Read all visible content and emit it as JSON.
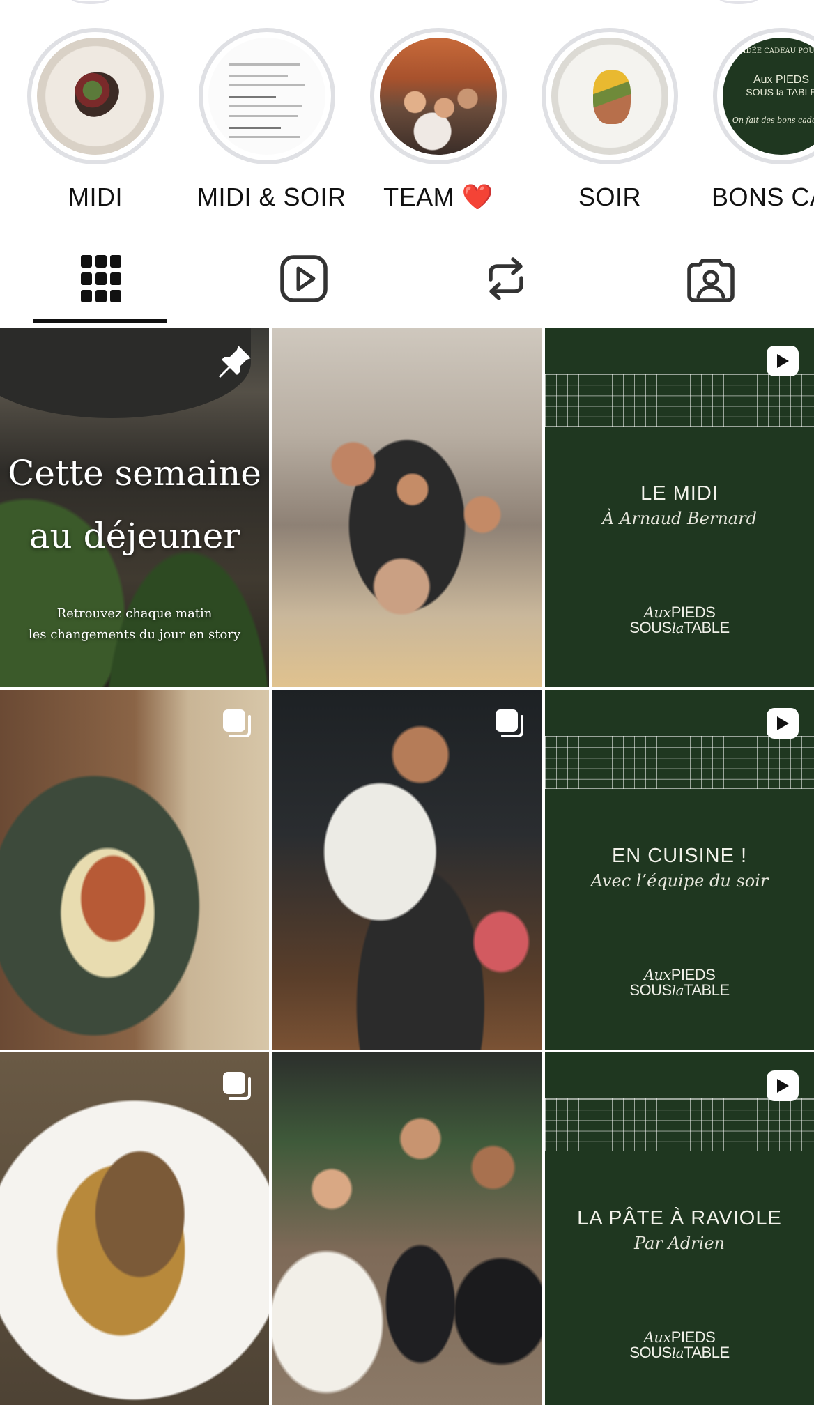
{
  "highlights": [
    {
      "label": "MIDI"
    },
    {
      "label": "MIDI & SOIR"
    },
    {
      "label": "TEAM ❤️"
    },
    {
      "label": "SOIR"
    },
    {
      "label": "BONS CA"
    }
  ],
  "gift_thumb": {
    "top_text": "S D'IDÉE CADEAU POUR NO",
    "logo_line1": "Aux PIEDS",
    "logo_line2": "SOUS la TABLE",
    "bottom_text": "On fait des bons cadeaux"
  },
  "tabs": [
    {
      "name": "grid-icon",
      "active": true
    },
    {
      "name": "reels-icon",
      "active": false
    },
    {
      "name": "reposts-icon",
      "active": false
    },
    {
      "name": "tagged-icon",
      "active": false
    }
  ],
  "posts": {
    "p1": {
      "title_line1": "Cette semaine",
      "title_line2": "au déjeuner",
      "small_line1": "Retrouvez chaque matin",
      "small_line2": "les changements du jour en story",
      "badge": "pin-icon"
    },
    "p3": {
      "title": "LE MIDI",
      "subtitle": "À Arnaud Bernard",
      "badge": "reel-icon"
    },
    "p6": {
      "title": "EN CUISINE !",
      "subtitle": "Avec l’équipe du soir",
      "badge": "reel-icon"
    },
    "p9": {
      "title": "LA PÂTE À RAVIOLE",
      "subtitle": "Par Adrien",
      "badge": "reel-icon"
    }
  },
  "logo": {
    "aux": "Aux",
    "pieds": "PIEDS",
    "sous": "SOUS",
    "la": "la",
    "table": "TABLE"
  },
  "colors": {
    "brand_green": "#1f3720",
    "ring": "#dfe0e4",
    "text": "#111111"
  }
}
